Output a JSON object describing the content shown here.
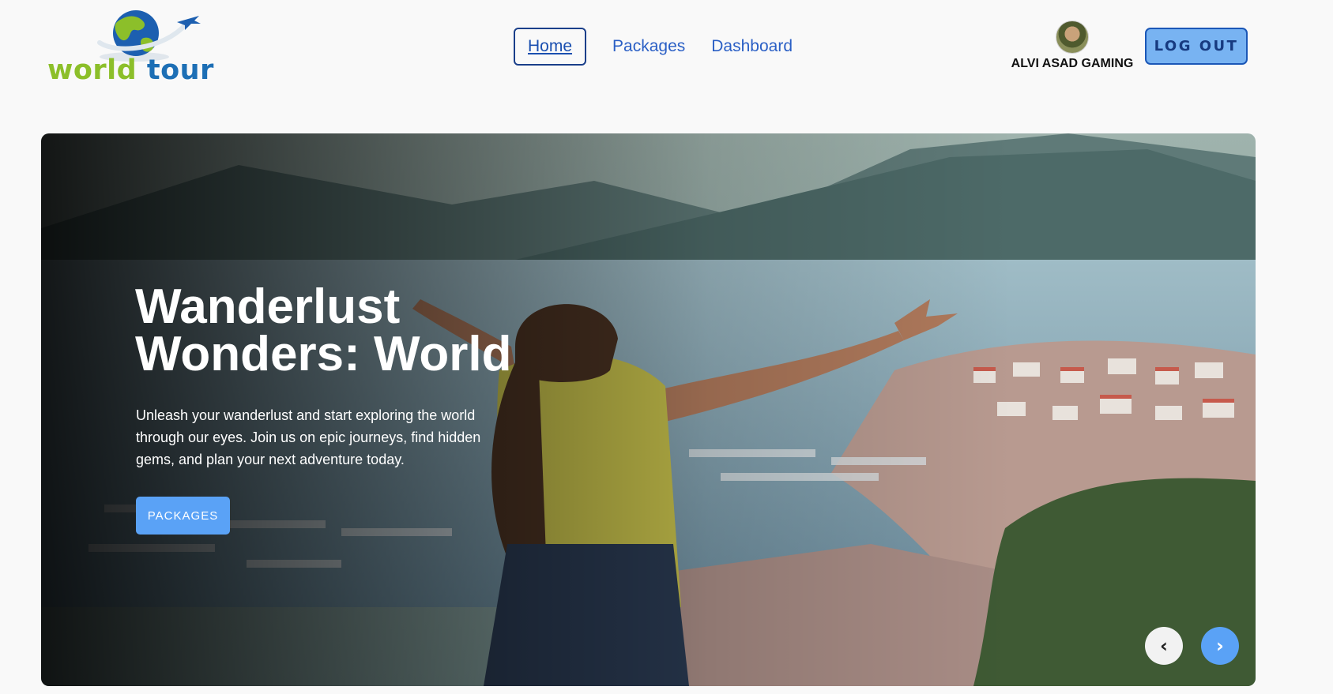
{
  "brand": {
    "logo_word1": "world",
    "logo_word2": "tour",
    "color_green": "#8cbf2a",
    "color_blue": "#1d6fb5"
  },
  "nav": {
    "links": [
      {
        "label": "Home",
        "active": true
      },
      {
        "label": "Packages",
        "active": false
      },
      {
        "label": "Dashboard",
        "active": false
      }
    ],
    "link_color": "#2a5fc5"
  },
  "user": {
    "name": "ALVI ASAD GAMING",
    "avatar_icon": "user-avatar"
  },
  "logout": {
    "label": "LOG OUT",
    "bg_color": "#78b3f2"
  },
  "hero": {
    "title": "Wanderlust Wonders: World",
    "description": "Unleash your wanderlust and start exploring the world through our eyes. Join us on epic journeys, find hidden gems, and plan your next adventure today.",
    "button_label": "PACKAGES",
    "button_color": "#5aa2f6",
    "prev_icon": "‹",
    "next_icon": "›"
  }
}
